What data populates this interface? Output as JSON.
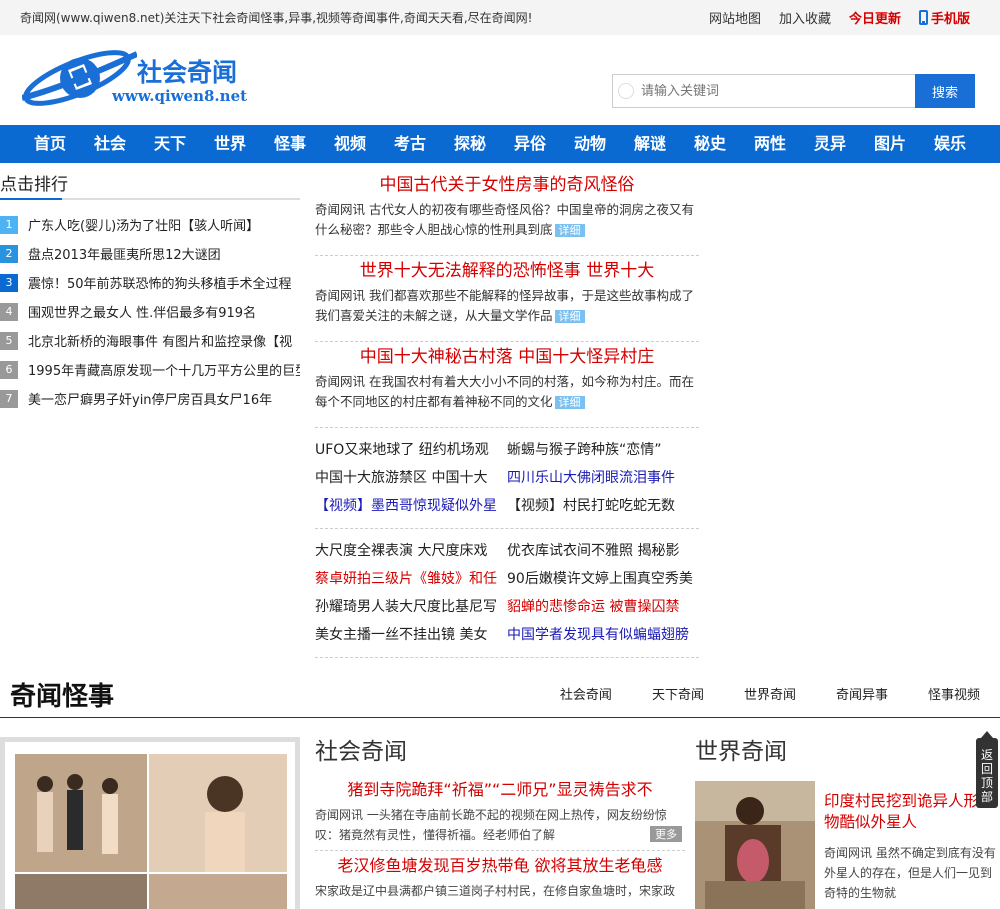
{
  "topbar": {
    "tagline": "奇闻网(www.qiwen8.net)关注天下社会奇闻怪事,异事,视频等奇闻事件,奇闻天天看,尽在奇闻网!",
    "sitemap": "网站地图",
    "favorite": "加入收藏",
    "today": "今日更新",
    "mobile": "手机版"
  },
  "logo": {
    "name": "社会奇闻",
    "url": "www.qiwen8.net"
  },
  "search": {
    "placeholder": "请输入关键词",
    "button": "搜索"
  },
  "nav": [
    "首页",
    "社会",
    "天下",
    "世界",
    "怪事",
    "视频",
    "考古",
    "探秘",
    "异俗",
    "动物",
    "解谜",
    "秘史",
    "两性",
    "灵异",
    "图片",
    "娱乐"
  ],
  "rank": {
    "title": "点击排行",
    "items": [
      "广东人吃(婴儿)汤为了壮阳【骇人听闻】",
      "盘点2013年最匪夷所思12大谜团",
      "震惊！50年前苏联恐怖的狗头移植手术全过程",
      "围观世界之最女人 性.伴侣最多有919名",
      "北京北新桥的海眼事件 有图片和监控录像【视",
      "1995年青藏高原发现一个十几万平方公里的巨型",
      "美一恋尸癖男子奸yin停尸房百具女尸16年"
    ]
  },
  "articles": [
    {
      "title": "中国古代关于女性房事的奇风怪俗",
      "summary": "奇闻网讯 古代女人的初夜有哪些奇怪风俗？中国皇帝的洞房之夜又有什么秘密？那些令人胆战心惊的性刑具到底",
      "more": "详细"
    },
    {
      "title": "世界十大无法解释的恐怖怪事 世界十大",
      "summary": "奇闻网讯 我们都喜欢那些不能解释的怪异故事，于是这些故事构成了我们喜爱关注的未解之谜，从大量文学作品",
      "more": "详细"
    },
    {
      "title": "中国十大神秘古村落 中国十大怪异村庄",
      "summary": "奇闻网讯 在我国农村有着大大小小不同的村落，如今称为村庄。而在每个不同地区的村庄都有着神秘不同的文化",
      "more": "详细"
    }
  ],
  "grid1": [
    {
      "text": "UFO又来地球了 纽约机场观",
      "color": "black"
    },
    {
      "text": "蜥蜴与猴子跨种族“恋情”",
      "color": "black"
    },
    {
      "text": "中国十大旅游禁区 中国十大",
      "color": "black"
    },
    {
      "text": "四川乐山大佛闭眼流泪事件",
      "color": "blue"
    },
    {
      "text": "【视频】墨西哥惊现疑似外星",
      "color": "blue"
    },
    {
      "text": "【视频】村民打蛇吃蛇无数",
      "color": "black"
    }
  ],
  "grid2": [
    {
      "text": "大尺度全裸表演 大尺度床戏",
      "color": "black"
    },
    {
      "text": "优衣库试衣间不雅照 揭秘影",
      "color": "black"
    },
    {
      "text": "蔡卓妍拍三级片《雏妓》和任",
      "color": "red"
    },
    {
      "text": "90后嫩模许文婷上围真空秀美",
      "color": "black"
    },
    {
      "text": "孙耀琦男人装大尺度比基尼写",
      "color": "black"
    },
    {
      "text": "貂蝉的悲惨命运 被曹操囚禁",
      "color": "red"
    },
    {
      "text": "美女主播一丝不挂出镜 美女",
      "color": "black"
    },
    {
      "text": "中国学者发现具有似蝙蝠翅膀",
      "color": "blue"
    }
  ],
  "section": {
    "title": "奇闻怪事",
    "tabs": [
      "社会奇闻",
      "天下奇闻",
      "世界奇闻",
      "奇闻异事",
      "怪事视频"
    ]
  },
  "social": {
    "title": "社会奇闻",
    "items": [
      {
        "title": "猪到寺院跪拜“祈福”“二师兄”显灵祷告求不",
        "summary": "奇闻网讯 一头猪在寺庙前长跪不起的视频在网上热传，网友纷纷惊叹：猪竟然有灵性，懂得祈福。经老师伯了解",
        "more": "更多"
      },
      {
        "title": "老汉修鱼塘发现百岁热带龟 欲将其放生老龟感",
        "summary": "宋家政是辽中县满都户镇三道岗子村村民，在修自家鱼塘时，宋家政",
        "more": ""
      }
    ]
  },
  "world": {
    "title": "世界奇闻",
    "headline": "印度村民挖到诡异人形生物酷似外星人",
    "summary": "奇闻网讯 虽然不确定到底有没有外星人的存在，但是人们一见到奇特的生物就"
  },
  "backtop": "返回顶部",
  "colors": {
    "brand": "#0a6ad2",
    "accent": "#d40000"
  }
}
